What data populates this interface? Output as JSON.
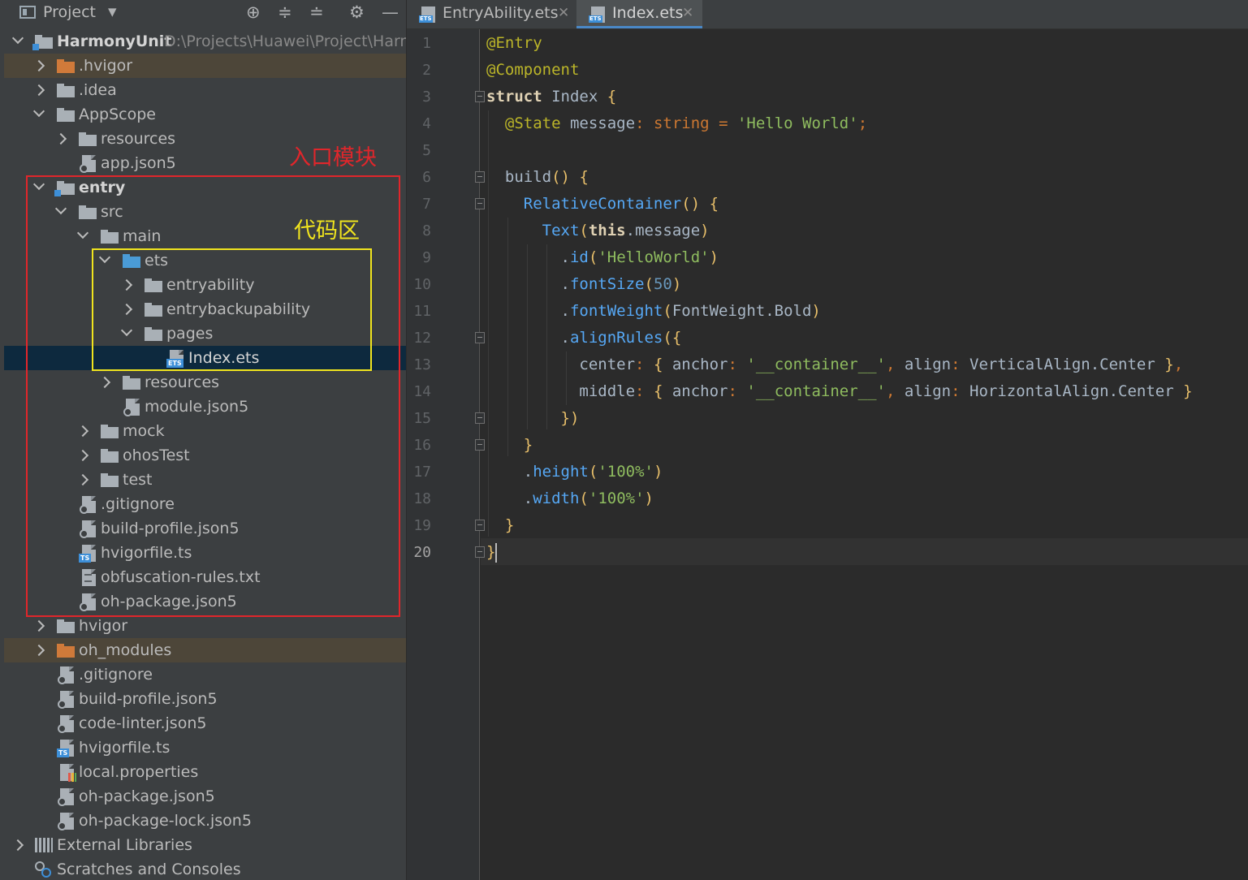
{
  "project_panel": {
    "title": "Project",
    "toolbar_icons": [
      "locate-icon",
      "expand-all-icon",
      "collapse-all-icon",
      "gear-icon",
      "minimize-icon"
    ]
  },
  "tree": {
    "root": {
      "label": "HarmonyUnit",
      "path": "D:\\Projects\\Huawei\\Project\\Harmo"
    },
    "items": [
      {
        "label": ".hvigor"
      },
      {
        "label": ".idea"
      },
      {
        "label": "AppScope"
      },
      {
        "label": "resources"
      },
      {
        "label": "app.json5"
      },
      {
        "label": "entry"
      },
      {
        "label": "src"
      },
      {
        "label": "main"
      },
      {
        "label": "ets"
      },
      {
        "label": "entryability"
      },
      {
        "label": "entrybackupability"
      },
      {
        "label": "pages"
      },
      {
        "label": "Index.ets"
      },
      {
        "label": "resources"
      },
      {
        "label": "module.json5"
      },
      {
        "label": "mock"
      },
      {
        "label": "ohosTest"
      },
      {
        "label": "test"
      },
      {
        "label": ".gitignore"
      },
      {
        "label": "build-profile.json5"
      },
      {
        "label": "hvigorfile.ts"
      },
      {
        "label": "obfuscation-rules.txt"
      },
      {
        "label": "oh-package.json5"
      },
      {
        "label": "hvigor"
      },
      {
        "label": "oh_modules"
      },
      {
        "label": ".gitignore"
      },
      {
        "label": "build-profile.json5"
      },
      {
        "label": "code-linter.json5"
      },
      {
        "label": "hvigorfile.ts"
      },
      {
        "label": "local.properties"
      },
      {
        "label": "oh-package.json5"
      },
      {
        "label": "oh-package-lock.json5"
      },
      {
        "label": "External Libraries"
      },
      {
        "label": "Scratches and Consoles"
      }
    ]
  },
  "annotations": {
    "entry_module": "入口模块",
    "code_area": "代码区",
    "entry_color": "#e0262b",
    "code_color": "#f0e41e"
  },
  "tabs": [
    {
      "label": "EntryAbility.ets",
      "icon_tag": "ETS",
      "active": false
    },
    {
      "label": "Index.ets",
      "icon_tag": "ETS",
      "active": true
    }
  ],
  "editor": {
    "line_numbers": [
      "1",
      "2",
      "3",
      "4",
      "5",
      "6",
      "7",
      "8",
      "9",
      "10",
      "11",
      "12",
      "13",
      "14",
      "15",
      "16",
      "17",
      "18",
      "19",
      "20"
    ],
    "current_line": "20",
    "lines": [
      "@Entry",
      "@Component",
      "struct Index {",
      "  @State message: string = 'Hello World';",
      "",
      "  build() {",
      "    RelativeContainer() {",
      "      Text(this.message)",
      "        .id('HelloWorld')",
      "        .fontSize(50)",
      "        .fontWeight(FontWeight.Bold)",
      "        .alignRules({",
      "          center: { anchor: '__container__', align: VerticalAlign.Center },",
      "          middle: { anchor: '__container__', align: HorizontalAlign.Center }",
      "        })",
      "    }",
      "    .height('100%')",
      "    .width('100%')",
      "  }",
      "}"
    ]
  }
}
